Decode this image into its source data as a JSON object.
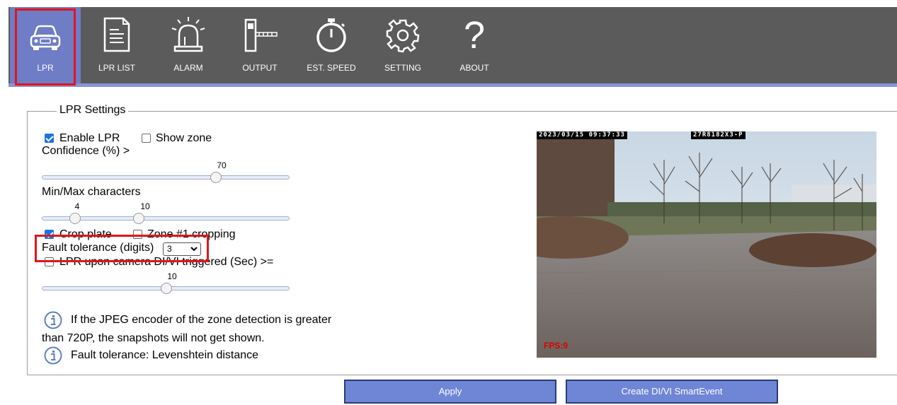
{
  "nav": {
    "items": [
      {
        "label": "LPR"
      },
      {
        "label": "LPR LIST"
      },
      {
        "label": "ALARM"
      },
      {
        "label": "OUTPUT"
      },
      {
        "label": "EST. SPEED"
      },
      {
        "label": "SETTING"
      },
      {
        "label": "ABOUT"
      }
    ],
    "active": "LPR"
  },
  "settings": {
    "legend": "LPR Settings",
    "enable_lpr": {
      "label": "Enable LPR",
      "checked": true
    },
    "show_zone": {
      "label": "Show zone",
      "checked": false
    },
    "confidence": {
      "label": "Confidence (%) >",
      "value": "70"
    },
    "minmax": {
      "label": "Min/Max characters",
      "min": "4",
      "max": "10"
    },
    "crop_plate": {
      "label": "Crop plate",
      "checked": true
    },
    "zone_cropping": {
      "label": "Zone #1 cropping",
      "checked": false
    },
    "fault_tolerance": {
      "label": "Fault tolerance (digits)",
      "value": "3"
    },
    "lpr_trigger": {
      "label": "LPR upon camera DI/VI triggered (Sec) >=",
      "checked": false,
      "value": "10"
    },
    "info1_line1": "If the JPEG encoder of the zone detection is greater",
    "info1_line2": "than 720P, the snapshots will not get shown.",
    "info2": "Fault tolerance: Levenshtein distance"
  },
  "camera": {
    "timestamp": "2023/03/15 09:37:33",
    "device_id": "27R8182X3-P",
    "fps": "FPS:9"
  },
  "buttons": {
    "apply": "Apply",
    "create_event": "Create DI/VI SmartEvent"
  },
  "colors": {
    "nav_bg": "#5b5b5b",
    "nav_active": "#6f7cc6",
    "highlight": "#e0161b",
    "button": "#6f86d6"
  }
}
